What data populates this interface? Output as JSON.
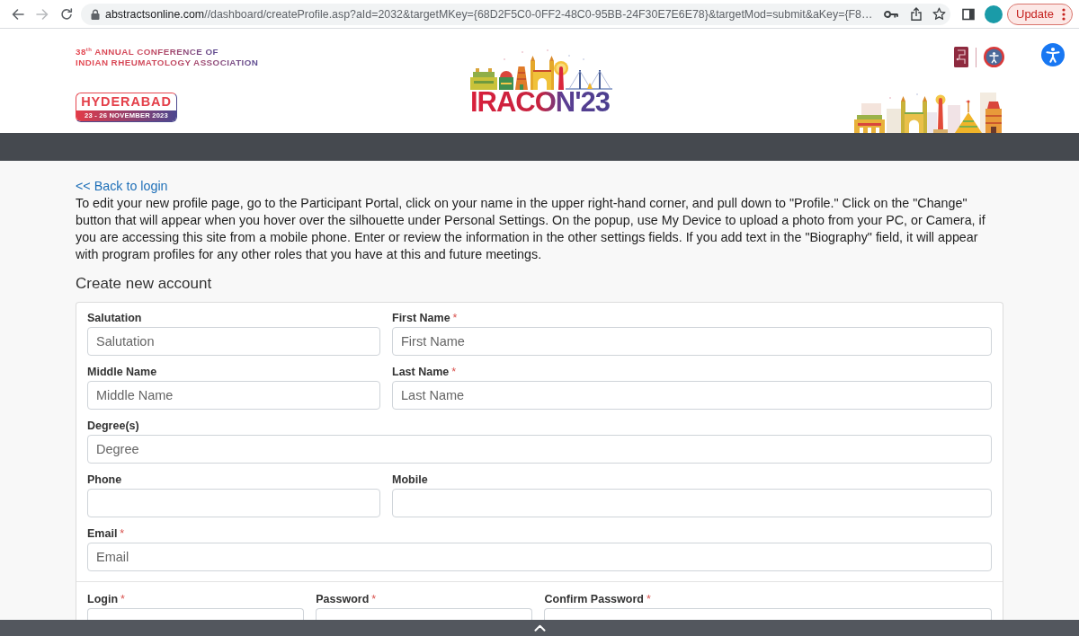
{
  "browser": {
    "url_domain": "abstractsonline.com",
    "url_path": "//dashboard/createProfile.asp?aId=2032&targetMKey={68D2F5C0-0FF2-48C0-95BB-24F30E7E6E78}&targetMod=submit&aKey={F8…",
    "update_button": "Update"
  },
  "header": {
    "conference_lines": [
      "38$^{th}$ ANNUAL CONFERENCE OF",
      "INDIAN RHEUMATOLOGY ASSOCIATION"
    ],
    "city": "HYDERABAD",
    "dates": "23 - 26 NOVEMBER 2023",
    "logo_text": "IRACON'23"
  },
  "back_link": "<< Back to login",
  "intro": "To edit your new profile page, go to the Participant Portal, click on your name in the upper right-hand corner, and pull down to \"Profile.\" Click on the \"Change\" button that will appear when you hover over the silhouette under Personal Settings. On the popup, use My Device to upload a photo from your PC, or Camera, if you are accessing this site from a mobile phone. Enter or review the information in the other settings fields. If you add text in the \"Biography\" field, it will appear with program profiles for any other roles that you have at this and future meetings.",
  "form": {
    "title": "Create new account",
    "rows": [
      {
        "kind": "split",
        "fields": [
          {
            "label": "Salutation",
            "placeholder": "Salutation"
          },
          {
            "label": "First Name",
            "required_mark": "*",
            "placeholder": "First Name"
          }
        ]
      },
      {
        "kind": "split",
        "fields": [
          {
            "label": "Middle Name",
            "placeholder": "Middle Name"
          },
          {
            "label": "Last Name",
            "required_mark": "*",
            "placeholder": "Last Name"
          }
        ]
      },
      {
        "kind": "full",
        "fields": [
          {
            "label": "Degree(s)",
            "placeholder": "Degree"
          }
        ]
      },
      {
        "kind": "split",
        "fields": [
          {
            "label": "Phone"
          },
          {
            "label": "Mobile"
          }
        ]
      },
      {
        "kind": "full",
        "fields": [
          {
            "label": "Email",
            "required_mark": "*",
            "placeholder": "Email"
          }
        ]
      },
      {
        "kind": "account",
        "fields": [
          {
            "label": "Login",
            "required_mark": "*"
          },
          {
            "label": "Password",
            "required_mark": "*"
          },
          {
            "label": "Confirm Password",
            "required_mark": "*"
          }
        ]
      }
    ]
  }
}
